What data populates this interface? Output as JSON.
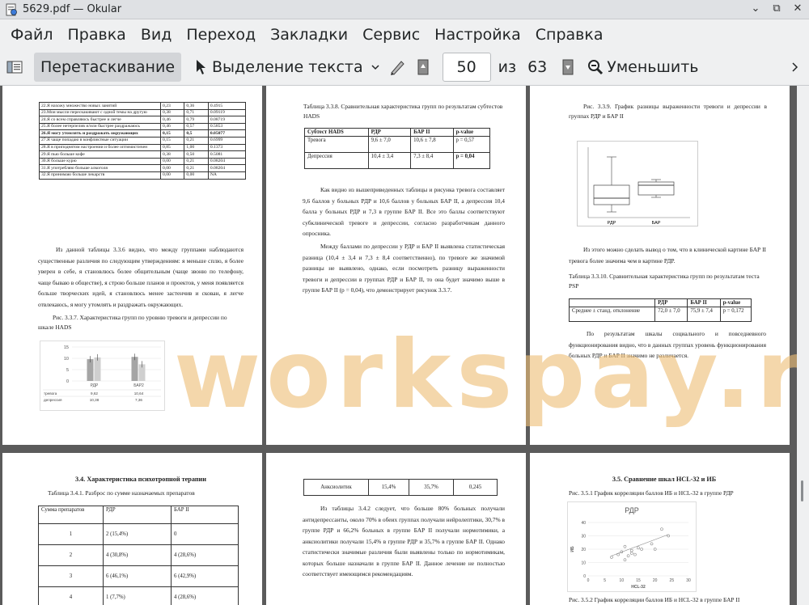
{
  "window": {
    "title": "5629.pdf  — Okular",
    "controls": [
      "⌄",
      "⧉",
      "✕"
    ]
  },
  "menu": [
    "Файл",
    "Правка",
    "Вид",
    "Переход",
    "Закладки",
    "Сервис",
    "Настройка",
    "Справка"
  ],
  "toolbar": {
    "browse_label": "Перетаскивание",
    "select_label": "Выделение текста",
    "page_current": "50",
    "page_of": "из",
    "page_total": "63",
    "zoom_out_label": "Уменьшить"
  },
  "watermark": "workspay.ru",
  "page1": {
    "table": [
      [
        "22.Я нахожу множество новых занятий",
        "0,23",
        "0,36",
        "0.4915"
      ],
      [
        "23.Мои мысли перескакивают с одной темы на другую",
        "0,38",
        "0,71",
        "0.09119"
      ],
      [
        "24.Я со всем справляюсь быстрее и легче",
        "0,46",
        "0,79",
        "0.08719"
      ],
      [
        "25.Я более нетерпелив и/или быстрее раздражаюсь",
        "0,46",
        "0,57",
        "0.5853"
      ],
      [
        "26.Я могу утомлять и раздражать окружающих",
        "0,15",
        "0,5",
        "0.05077"
      ],
      [
        "27.Я чаще попадаю в конфликтные ситуации",
        "0,15",
        "0,21",
        "0.6999"
      ],
      [
        "28.Я в приподнятом настроении и более оптимистичен",
        "0,85",
        "1,00",
        "0.1373"
      ],
      [
        "29.Я пью больше кофе",
        "0,38",
        "0,50",
        "0.5081"
      ],
      [
        "30.Я больше курю",
        "0,00",
        "0,21",
        "0.08204"
      ],
      [
        "31.Я употребляю больше алкоголя",
        "0,00",
        "0,21",
        "0.08204"
      ],
      [
        "32.Я принимаю больше лекарств",
        "0,00",
        "0,00",
        "NA"
      ]
    ],
    "paragraph": "Из данной таблицы 3.3.6 видно, что между группами наблюдаются существенные различия по следующим утверждениям: я меньше сплю, я более уверен в себе, я становлюсь более общительным (чаще звоню по телефону, чаще бываю в обществе), я строю больше планов и проектов, у меня появляется больше творческих идей, я становлюсь менее застенчив и скован, я легче отвлекаюсь, я могу утомлять и раздражать окружающих.",
    "caption": "Рис. 3.3.7. Характеристика групп по уровню тревоги и депрессии по шкале HADS",
    "chart": {
      "categories": [
        "РДР",
        "БАР2"
      ],
      "series": [
        {
          "name": "тревога",
          "values": [
            9.62,
            10.64
          ],
          "color": "#a5a5a5"
        },
        {
          "name": "депрессия",
          "values": [
            10.38,
            7.36
          ],
          "color": "#cfcfcf"
        }
      ],
      "y_ticks": [
        "15",
        "10",
        "5",
        "0"
      ],
      "ylim": [
        0,
        15
      ],
      "table_rows": [
        [
          "тревога",
          "9,62",
          "10,64"
        ],
        [
          "депрессия",
          "10,38",
          "7,36"
        ]
      ]
    }
  },
  "page2": {
    "table_caption": "Таблица 3.3.8. Сравнительная характеристика групп по результатам субтестов HADS",
    "table_header": [
      "Субтест HADS",
      "РДР",
      "БАР II",
      "p-value"
    ],
    "table_rows": [
      [
        "Тревога",
        "9,6 ± 7,0",
        "10,6 ± 7,8",
        "p = 0,57"
      ],
      [
        "Депрессия",
        "10,4 ± 3,4",
        "7,3 ± 8,4",
        "p = 0,04"
      ]
    ],
    "paragraph1": "Как видно из вышеприведенных таблицы и рисунка тревога составляет 9,6 баллов у больных РДР и 10,6 баллов у больных БАР II, а депрессия 10,4 балла у больных РДР и 7,3 в группе БАР II. Все это баллы соответствуют субклинической тревоге и депрессии, согласно разработчикам данного опросника.",
    "paragraph2": "Между баллами по депрессии у РДР и БАР II выявлена статистическая разница (10,4 ± 3,4 и 7,3 ± 8,4 соответственно), по тревоге же значимой разницы не выявлено, однако, если посмотреть разницу выраженности тревоги и депрессии в группах РДР и БАР II, то она будет значимо выше в группе БАР II (p = 0,04), что демонстрирует рисунок 3.3.7."
  },
  "page3": {
    "caption": "Рис. 3.3.9. График разницы выраженности тревоги и депрессии в группах РДР и БАР II",
    "boxplot_labels": [
      "РДР",
      "БАР"
    ],
    "paragraph1": "Из этого можно сделать вывод о том, что в клинической картине БАР II тревога более значима чем в картине РДР.",
    "table_caption": "Таблица 3.3.10. Сравнительная характеристика групп по результатам теста PSP",
    "table_header": [
      "",
      "РДР",
      "БАР II",
      "p-value"
    ],
    "table_rows": [
      [
        "Среднее ± станд. отклонение",
        "72,0 ± 7,0",
        "75,9 ± 7,4",
        "p = 0,172"
      ]
    ],
    "paragraph2": "По результатам шкалы социального и повседневного функционирования видно, что в данных группах уровень функционирования больных РДР и БАР II значимо не различается."
  },
  "page4": {
    "heading": "3.4. Характеристика психотропной терапии",
    "table_caption": "Таблица 3.4.1. Разброс по сумме назначаемых препаратов",
    "table_header": [
      "Сумма препаратов",
      "РДР",
      "БАР II"
    ],
    "table_rows": [
      [
        "1",
        "2 (15,4%)",
        "0"
      ],
      [
        "2",
        "4 (30,8%)",
        "4 (28,6%)"
      ],
      [
        "3",
        "6 (46,1%)",
        "6 (42,9%)"
      ],
      [
        "4",
        "1 (7,7%)",
        "4 (28,6%)"
      ]
    ]
  },
  "page5": {
    "table_row": [
      "Анксиолитик",
      "15,4%",
      "35,7%",
      "0,245"
    ],
    "paragraph": "Из таблицы 3.4.2 следует, что больше 80% больных получали антидепрессанты, около 70% в обеих группах получали нейролептики, 30,7% в группе РДР и 66,2% больных в группе БАР II получали нормотимики, а анксиолитики получали 15,4% в группе РДР и 35,7% в группе БАР II. Однако статистически значимые различия были выявлены только по нормотимикам, которых больше назначали в группе БАР II. Данное лечение не полностью соответствует имеющимся рекомендациям."
  },
  "page6": {
    "heading": "3.5. Сравнение шкал HCL-32 и ИБ",
    "caption1": "Рис. 3.5.1 График корреляции баллов ИБ и HCL-32 в группе РДР",
    "chart": {
      "type": "scatter",
      "title": "РДР",
      "xlabel": "HCL-32",
      "ylabel": "ИБ",
      "x_ticks": [
        "0",
        "5",
        "10",
        "15",
        "20",
        "25",
        "30"
      ],
      "y_ticks": [
        "40",
        "30",
        "20",
        "10",
        "0"
      ],
      "xlim": [
        0,
        30
      ],
      "ylim": [
        0,
        40
      ],
      "points": [
        [
          7,
          14
        ],
        [
          9,
          16
        ],
        [
          10,
          18
        ],
        [
          11,
          12
        ],
        [
          11,
          22
        ],
        [
          12,
          15
        ],
        [
          13,
          17
        ],
        [
          13,
          19
        ],
        [
          14,
          16
        ],
        [
          15,
          21
        ],
        [
          16,
          20
        ],
        [
          19,
          24
        ],
        [
          20,
          20
        ],
        [
          22,
          35
        ],
        [
          24,
          30
        ]
      ],
      "trend": [
        [
          7,
          15
        ],
        [
          24,
          31
        ]
      ]
    },
    "caption2": "Рис. 3.5.2 График корреляции баллов ИБ и HCL-32 в группе БАР II"
  }
}
